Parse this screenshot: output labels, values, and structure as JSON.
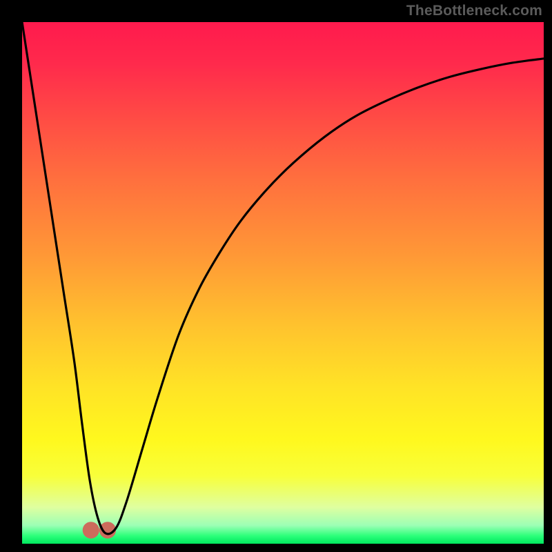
{
  "watermark": "TheBottleneck.com",
  "chart_data": {
    "type": "line",
    "title": "",
    "xlabel": "",
    "ylabel": "",
    "xlim": [
      0,
      100
    ],
    "ylim": [
      0,
      100
    ],
    "grid": false,
    "series": [
      {
        "name": "curve",
        "x": [
          0,
          2,
          4,
          6,
          8,
          10,
          11.5,
          13,
          14.5,
          16,
          18,
          20,
          23,
          26,
          30,
          34,
          38,
          42,
          47,
          52,
          58,
          64,
          70,
          76,
          82,
          88,
          94,
          100
        ],
        "y": [
          100,
          87,
          74,
          61,
          48,
          35,
          23,
          12,
          5,
          2,
          3,
          8,
          18,
          28,
          40,
          49,
          56,
          62,
          68,
          73,
          78,
          82,
          85,
          87.5,
          89.5,
          91,
          92.2,
          93
        ]
      }
    ],
    "markers": [
      {
        "name": "lobe-left",
        "cx": 13.2,
        "cy": 2.6,
        "r": 1.6
      },
      {
        "name": "lobe-right",
        "cx": 16.4,
        "cy": 2.6,
        "r": 1.6
      }
    ],
    "colors": {
      "curve": "#000000",
      "marker": "#cc6b5c",
      "gradient_top": "#ff1a4d",
      "gradient_bottom": "#00e85f"
    }
  }
}
